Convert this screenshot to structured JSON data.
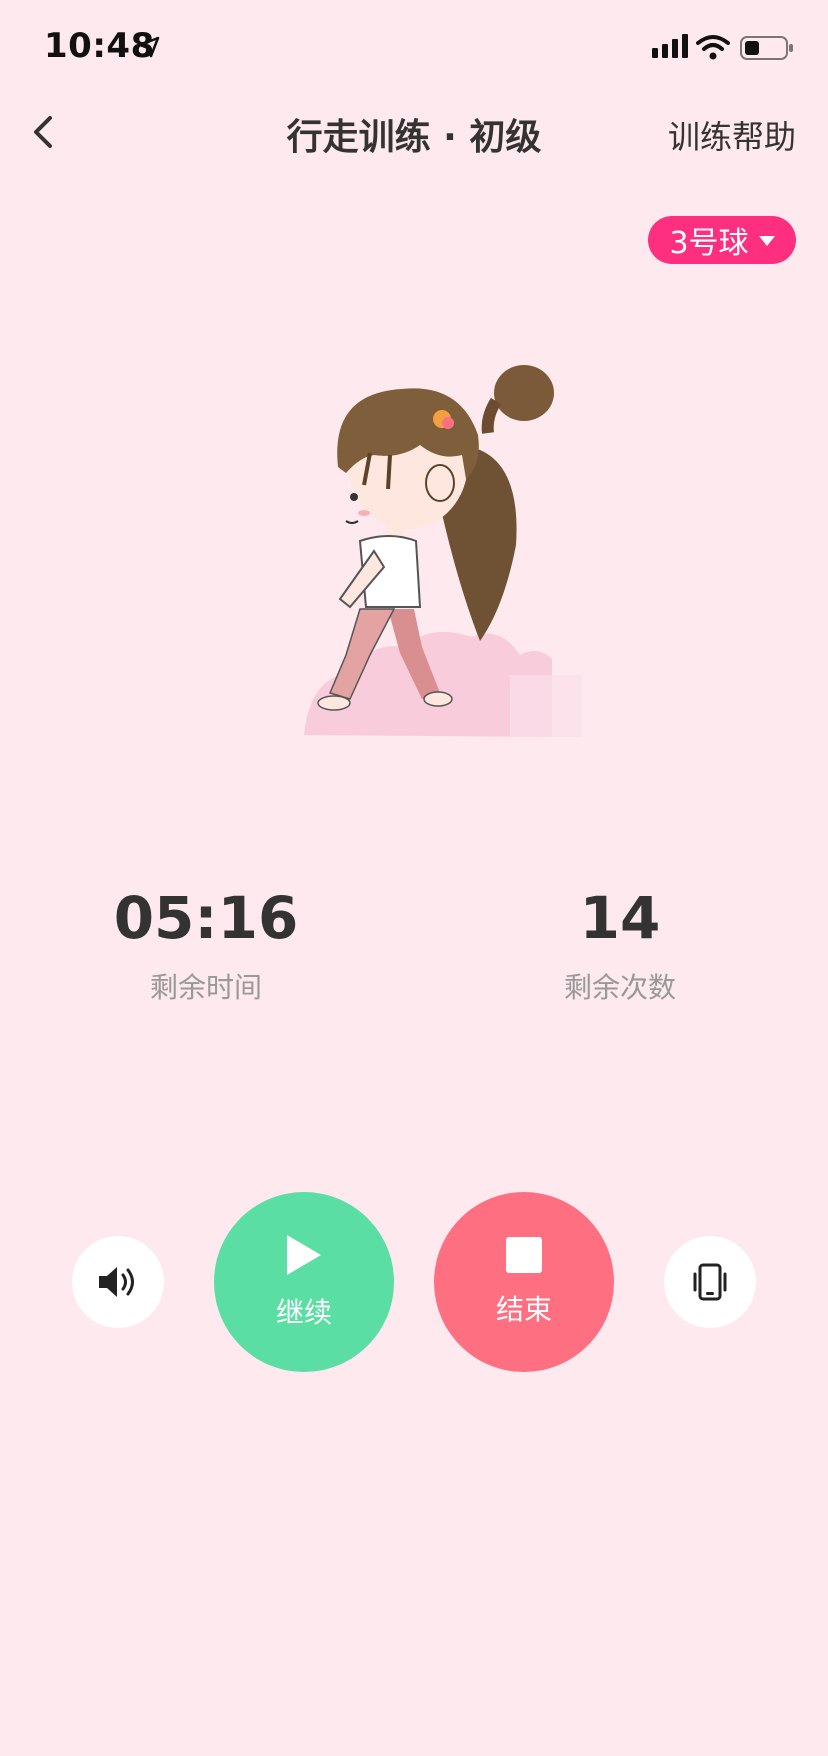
{
  "status_bar": {
    "time": "10:48",
    "icons": [
      "location-arrow-icon",
      "cellular-signal-icon",
      "wifi-icon",
      "battery-icon"
    ]
  },
  "nav": {
    "back_icon": "chevron-left-icon",
    "title": "行走训练 · 初级",
    "help_label": "训练帮助"
  },
  "ball_selector": {
    "label": "3号球",
    "icon": "caret-down-icon",
    "color": "#fe2f7e"
  },
  "stats": {
    "remaining_time": {
      "value": "05:16",
      "label": "剩余时间"
    },
    "remaining_count": {
      "value": "14",
      "label": "剩余次数"
    }
  },
  "controls": {
    "sound_icon": "speaker-volume-icon",
    "continue": {
      "label": "继续",
      "icon": "play-icon",
      "color": "#5bdea4"
    },
    "end": {
      "label": "结束",
      "icon": "stop-icon",
      "color": "#ff6f82"
    },
    "vibrate_icon": "phone-vibrate-icon"
  },
  "colors": {
    "background": "#fde9ee",
    "accent": "#fe2f7e"
  }
}
